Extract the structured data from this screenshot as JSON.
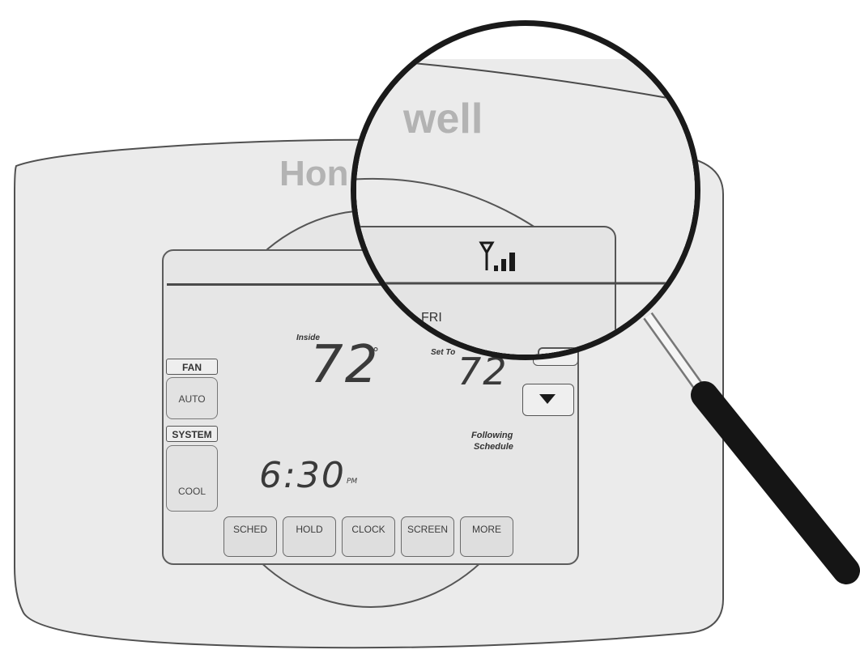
{
  "brand": {
    "name": "Honeywell",
    "lens_fragment": "well",
    "body_fragment": "Hon"
  },
  "side_panel": {
    "fan_label": "FAN",
    "fan_value": "AUTO",
    "system_label": "SYSTEM",
    "system_value": "COOL"
  },
  "display": {
    "inside_label": "Inside",
    "inside_temp": "72",
    "inside_unit": "°",
    "set_to_label": "Set To",
    "set_temp": "72",
    "day": "FRI",
    "time": "6:30",
    "time_ampm": "PM",
    "status_line1": "Following",
    "status_line2": "Schedule",
    "wifi_signal_bars": 3
  },
  "buttons": {
    "sched": "SCHED",
    "hold": "HOLD",
    "clock": "CLOCK",
    "screen": "SCREEN",
    "more": "MORE"
  },
  "icons": {
    "up": "up-arrow-icon",
    "down": "down-arrow-icon",
    "wifi": "wifi-signal-icon",
    "magnifier": "magnifying-glass-icon"
  }
}
